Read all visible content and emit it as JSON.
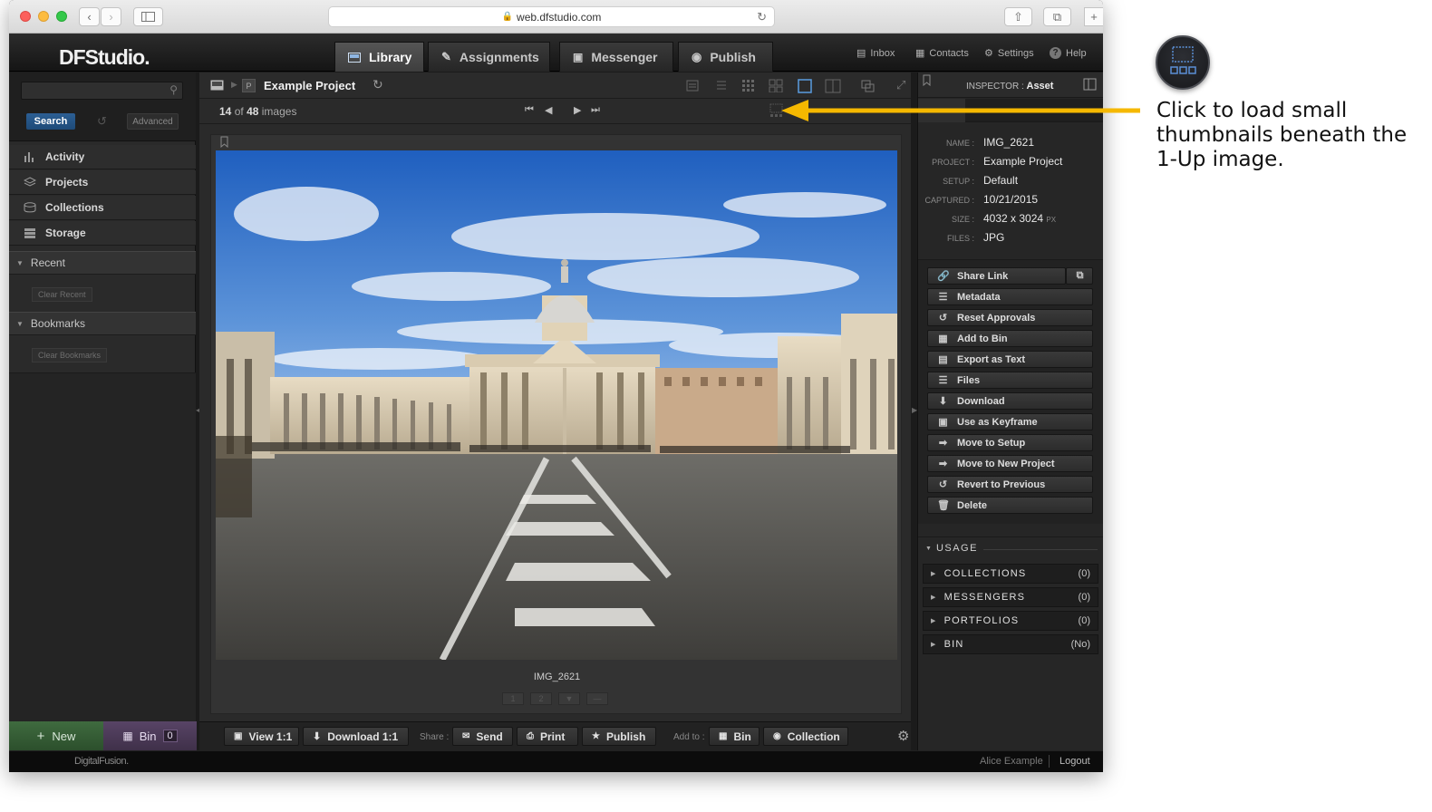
{
  "browser": {
    "url": "web.dfstudio.com"
  },
  "app": {
    "logo": "DFStudio.",
    "main_tabs": [
      {
        "label": "Library",
        "icon": "library-icon",
        "active": true
      },
      {
        "label": "Assignments",
        "icon": "assignments-icon",
        "active": false
      },
      {
        "label": "Messenger",
        "icon": "messenger-icon",
        "active": false
      },
      {
        "label": "Publish",
        "icon": "publish-icon",
        "active": false
      }
    ],
    "top_links": [
      {
        "label": "Inbox",
        "icon": "inbox-icon"
      },
      {
        "label": "Contacts",
        "icon": "contacts-icon"
      },
      {
        "label": "Settings",
        "icon": "gear-icon"
      },
      {
        "label": "Help",
        "icon": "help-icon"
      }
    ]
  },
  "sidebar": {
    "search": {
      "value": "",
      "search_label": "Search",
      "advanced_label": "Advanced"
    },
    "nav": [
      {
        "label": "Activity",
        "icon": "activity-icon"
      },
      {
        "label": "Projects",
        "icon": "projects-icon"
      },
      {
        "label": "Collections",
        "icon": "collections-icon"
      },
      {
        "label": "Storage",
        "icon": "storage-icon"
      }
    ],
    "recent": {
      "label": "Recent",
      "clear_label": "Clear Recent"
    },
    "bookmarks": {
      "label": "Bookmarks",
      "clear_label": "Clear Bookmarks"
    },
    "new_label": "New",
    "bin_label": "Bin",
    "bin_count": "0"
  },
  "center": {
    "project_badge": "P",
    "project_title": "Example Project",
    "count_current": "14",
    "count_of": "of",
    "count_total": "48",
    "count_unit": "images",
    "image_caption": "IMG_2621",
    "page_buttons": [
      "1",
      "2"
    ]
  },
  "bottom_toolbar": {
    "view_label": "View 1:1",
    "download_label": "Download 1:1",
    "share_label": "Share :",
    "send_label": "Send",
    "print_label": "Print",
    "publish_label": "Publish",
    "add_to_label": "Add to :",
    "bin_label": "Bin",
    "collection_label": "Collection"
  },
  "inspector": {
    "header_label": "INSPECTOR :",
    "header_value": "Asset",
    "meta": [
      {
        "key": "NAME :",
        "value": "IMG_2621",
        "unit": ""
      },
      {
        "key": "PROJECT :",
        "value": "Example Project",
        "unit": ""
      },
      {
        "key": "SETUP :",
        "value": "Default",
        "unit": ""
      },
      {
        "key": "CAPTURED :",
        "value": "10/21/2015",
        "unit": ""
      },
      {
        "key": "SIZE :",
        "value": "4032 x 3024",
        "unit": "PX"
      },
      {
        "key": "FILES :",
        "value": "JPG",
        "unit": ""
      }
    ],
    "actions": [
      {
        "label": "Share Link",
        "icon": "link-icon"
      },
      {
        "label": "Metadata",
        "icon": "metadata-icon"
      },
      {
        "label": "Reset Approvals",
        "icon": "reset-icon"
      },
      {
        "label": "Add to Bin",
        "icon": "bin-icon"
      },
      {
        "label": "Export as Text",
        "icon": "document-icon"
      },
      {
        "label": "Files",
        "icon": "files-icon"
      },
      {
        "label": "Download",
        "icon": "download-icon"
      },
      {
        "label": "Use as Keyframe",
        "icon": "keyframe-icon"
      },
      {
        "label": "Move to Setup",
        "icon": "arrow-right-icon"
      },
      {
        "label": "Move to New Project",
        "icon": "arrow-right-icon"
      },
      {
        "label": "Revert to Previous",
        "icon": "revert-icon"
      },
      {
        "label": "Delete",
        "icon": "trash-icon"
      }
    ],
    "usage_label": "USAGE",
    "usage": [
      {
        "label": "COLLECTIONS",
        "count": "(0)"
      },
      {
        "label": "MESSENGERS",
        "count": "(0)"
      },
      {
        "label": "PORTFOLIOS",
        "count": "(0)"
      },
      {
        "label": "BIN",
        "count": "(No)"
      }
    ]
  },
  "footer": {
    "brand": "DigitalFusion.",
    "user": "Alice Example",
    "logout": "Logout"
  },
  "annotation": {
    "text": "Click to load small thumbnails beneath the 1-Up image.",
    "arrow_color": "#f5b800"
  }
}
